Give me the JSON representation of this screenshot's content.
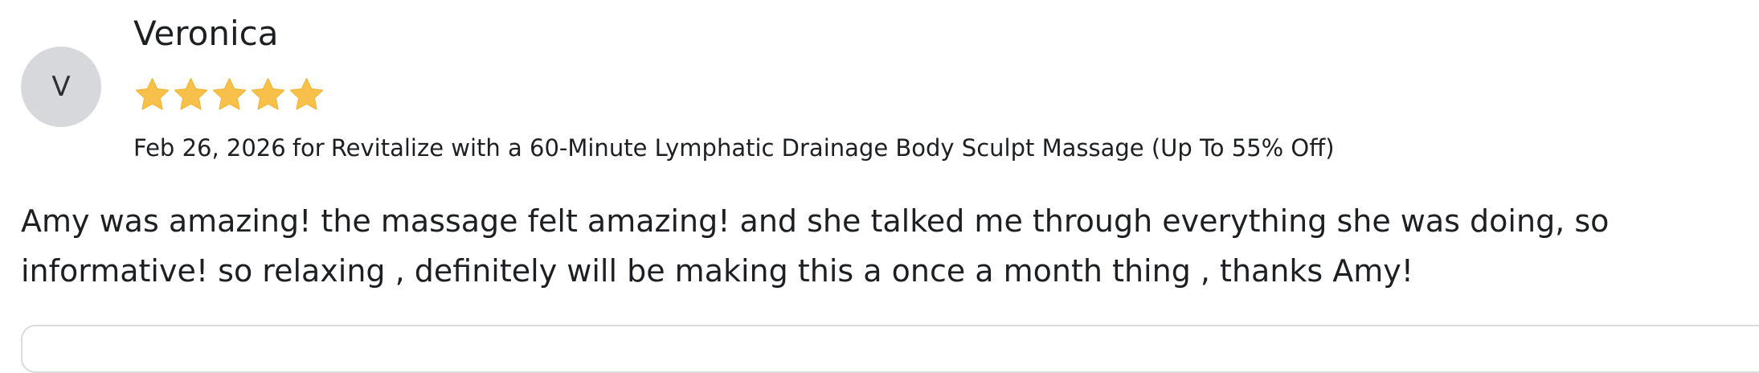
{
  "review": {
    "avatar_initial": "V",
    "reviewer_name": "Veronica",
    "rating": 5,
    "rating_max": 5,
    "star_color": "#f7c04a",
    "date": "Feb 26, 2026",
    "for_label": "for",
    "deal_title": "Revitalize with a 60-Minute Lymphatic Drainage Body Sculpt Massage (Up To 55% Off)",
    "text": "Amy was amazing! the massage felt amazing! and she talked me through everything she was doing, so informative! so relaxing , definitely will be making this a once a month thing , thanks Amy!"
  }
}
